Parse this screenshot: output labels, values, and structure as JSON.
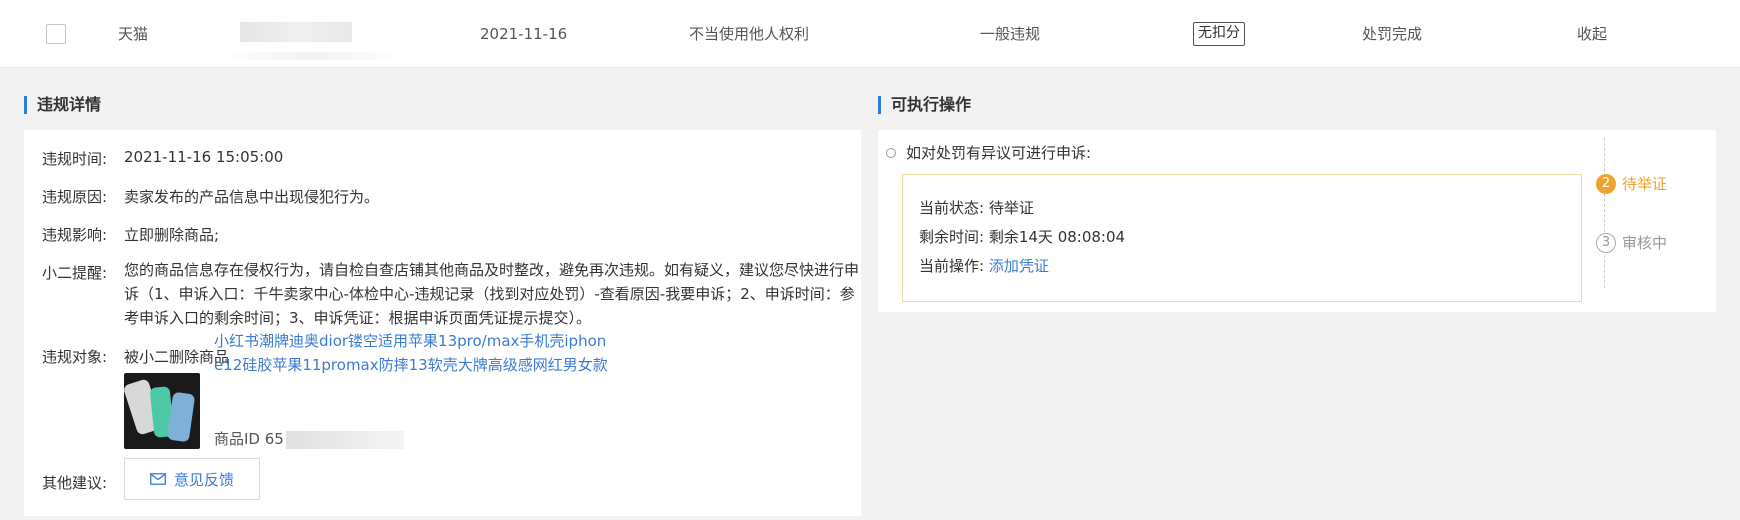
{
  "top_row": {
    "platform": "天猫",
    "date": "2021-11-16",
    "violation_type": "不当使用他人权利",
    "severity": "一般违规",
    "score_badge": "无扣分",
    "status": "处罚完成",
    "collapse_label": "收起"
  },
  "detail": {
    "section_title": "违规详情",
    "time_label": "违规时间:",
    "time_value": "2021-11-16 15:05:00",
    "reason_label": "违规原因:",
    "reason_value": "卖家发布的产品信息中出现侵犯行为。",
    "impact_label": "违规影响:",
    "impact_value": "立即删除商品;",
    "tip_label": "小二提醒:",
    "tip_value": "您的商品信息存在侵权行为，请自检自查店铺其他商品及时整改，避免再次违规。如有疑义，建议您尽快进行申诉（1、申诉入口：千牛卖家中心-体检中心-违规记录（找到对应处罚）-查看原因-我要申诉；2、申诉时间：参考申诉入口的剩余时间；3、申诉凭证：根据申诉页面凭证提示提交）。",
    "object_label": "违规对象:",
    "object_value": "被小二删除商品",
    "product_title_line1": "小红书潮牌迪奥dior镂空适用苹果13pro/max手机壳iphon",
    "product_title_line2": "e12硅胶苹果11promax防摔13软壳大牌高级感网红男女款",
    "product_id_prefix": "商品ID 65",
    "other_label": "其他建议:",
    "feedback_label": "意见反馈"
  },
  "actions": {
    "section_title": "可执行操作",
    "appeal_prompt": "如对处罚有异议可进行申诉:",
    "current_status_label": "当前状态:",
    "current_status_value": "待举证",
    "remaining_label": "剩余时间:",
    "remaining_value": "剩余14天 08:08:04",
    "current_action_label": "当前操作:",
    "current_action_link": "添加凭证",
    "steps": [
      {
        "num": "2",
        "label": "待举证"
      },
      {
        "num": "3",
        "label": "审核中"
      }
    ]
  },
  "colors": {
    "link": "#3a7bd5",
    "accent_bar": "#2a7fd6",
    "step_active": "#f0a32c",
    "status_box_border": "#f0dca0"
  },
  "icons": {
    "feedback": "mail-icon"
  }
}
